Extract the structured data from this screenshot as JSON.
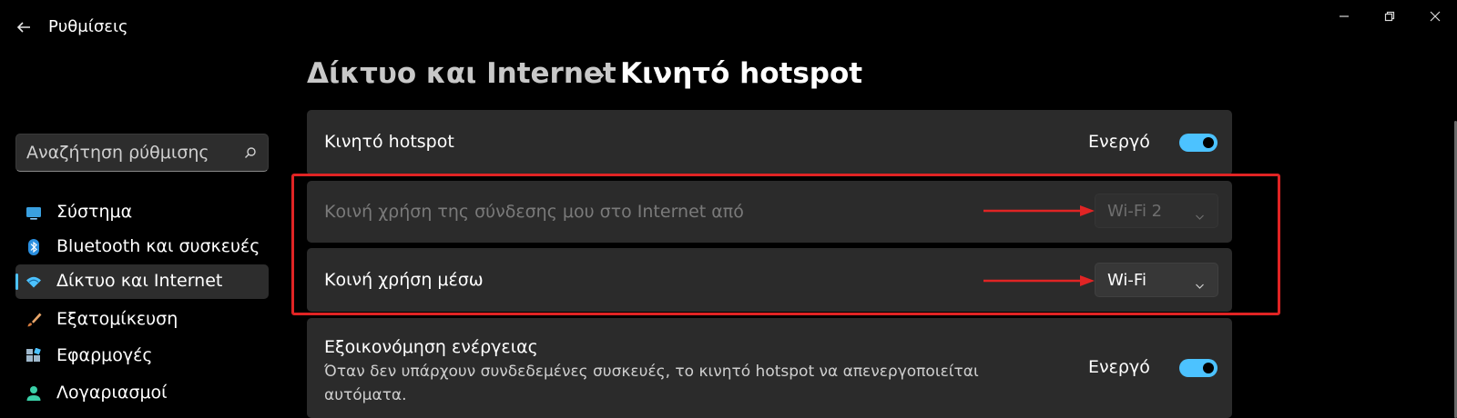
{
  "app": {
    "title": "Ρυθμίσεις"
  },
  "window_controls": {
    "minimize_icon": "minimize-icon",
    "maximize_icon": "restore-icon",
    "close_icon": "close-icon"
  },
  "sidebar": {
    "search": {
      "placeholder": "Αναζήτηση ρύθμισης",
      "icon": "search-icon"
    },
    "items": [
      {
        "label": "Σύστημα",
        "icon": "monitor-icon",
        "active": false
      },
      {
        "label": "Bluetooth και συσκευές",
        "icon": "bluetooth-icon",
        "active": false
      },
      {
        "label": "Δίκτυο και Internet",
        "icon": "wifi-icon",
        "active": true
      },
      {
        "label": "Εξατομίκευση",
        "icon": "brush-icon",
        "active": false
      },
      {
        "label": "Εφαρμογές",
        "icon": "apps-icon",
        "active": false
      },
      {
        "label": "Λογαριασμοί",
        "icon": "person-icon",
        "active": false
      }
    ]
  },
  "breadcrumb": {
    "parent": "Δίκτυο και Internet",
    "current": "Κινητό hotspot"
  },
  "cards": {
    "hotspot": {
      "label": "Κινητό hotspot",
      "state": "Ενεργό",
      "on": true
    },
    "share_from": {
      "label": "Κοινή χρήση της σύνδεσης μου στο Internet από",
      "value": "Wi-Fi 2",
      "disabled": true
    },
    "share_over": {
      "label": "Κοινή χρήση μέσω",
      "value": "Wi-Fi",
      "disabled": false
    },
    "power_saving": {
      "label": "Εξοικονόμηση ενέργειας",
      "description": "Όταν δεν υπάρχουν συνδεδεμένες συσκευές, το κινητό hotspot να απενεργοποιείται αυτόματα.",
      "state": "Ενεργό",
      "on": true
    }
  },
  "colors": {
    "accent": "#4cc2ff",
    "annotation": "#e02424",
    "card": "#2b2b2b",
    "background": "#000000"
  }
}
